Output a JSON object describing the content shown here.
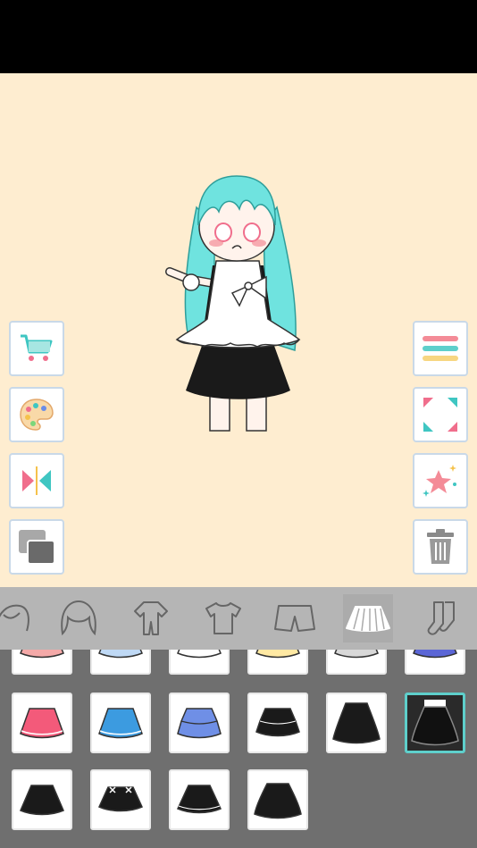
{
  "colors": {
    "stage_background": "#FEEDD0",
    "tab_bar": "#B5B5B5",
    "grid_background": "#6F6F6F",
    "selection_accent": "#5ECFCB"
  },
  "left_buttons": [
    {
      "name": "shop",
      "icon": "shopping-cart-icon"
    },
    {
      "name": "color",
      "icon": "palette-icon"
    },
    {
      "name": "flip",
      "icon": "mirror-flip-icon"
    },
    {
      "name": "layers",
      "icon": "layers-icon"
    }
  ],
  "right_buttons": [
    {
      "name": "menu",
      "icon": "menu-lines-icon"
    },
    {
      "name": "fullscreen",
      "icon": "fullscreen-icon"
    },
    {
      "name": "sparkle",
      "icon": "star-sparkle-icon"
    },
    {
      "name": "delete",
      "icon": "trash-icon"
    }
  ],
  "category_tabs": [
    {
      "name": "back-hair",
      "icon": "hair-back-icon"
    },
    {
      "name": "hair",
      "icon": "hair-icon"
    },
    {
      "name": "outfit",
      "icon": "jumpsuit-icon"
    },
    {
      "name": "top",
      "icon": "tshirt-icon"
    },
    {
      "name": "bottoms",
      "icon": "shorts-icon"
    },
    {
      "name": "skirt",
      "icon": "skirt-icon",
      "active": true
    },
    {
      "name": "socks",
      "icon": "socks-icon"
    }
  ],
  "skirt_items": [
    {
      "color": "#F4A9A8",
      "row": 0
    },
    {
      "color": "#BFD9F5",
      "row": 0
    },
    {
      "color": "#FFFFFF",
      "row": 0
    },
    {
      "color": "#FFE9A3",
      "row": 0
    },
    {
      "color": "#D8D8D8",
      "row": 0
    },
    {
      "color": "#5B66D6",
      "row": 0
    },
    {
      "color": "#F35A7A",
      "row": 1
    },
    {
      "color": "#3C9BE0",
      "row": 1
    },
    {
      "color": "#6F8FE6",
      "row": 1
    },
    {
      "color": "#1A1A1A",
      "row": 1
    },
    {
      "color": "#1A1A1A",
      "row": 1
    },
    {
      "color": "#1A1A1A",
      "row": 1,
      "selected": true
    },
    {
      "color": "#1A1A1A",
      "row": 2
    },
    {
      "color": "#1A1A1A",
      "row": 2
    },
    {
      "color": "#1A1A1A",
      "row": 2
    },
    {
      "color": "#1A1A1A",
      "row": 2
    }
  ]
}
